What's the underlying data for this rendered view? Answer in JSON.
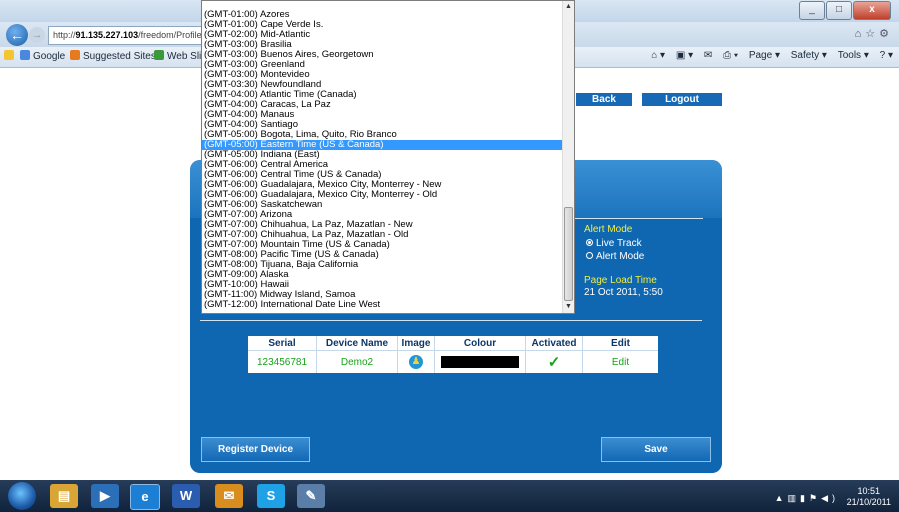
{
  "browser": {
    "url_prefix": "http://",
    "url_host": "91.135.227.103",
    "url_path": "/freedom/Profile",
    "favorites": [
      "Google",
      "Suggested Sites ▾",
      "Web Slice"
    ],
    "command_bar": [
      "Page ▾",
      "Safety ▾",
      "Tools ▾"
    ]
  },
  "nav": {
    "back_label": "Back",
    "logout_label": "Logout"
  },
  "timezone_dropdown": {
    "selected": "(GMT-05:00) Eastern Time (US & Canada)",
    "options": [
      "(GMT-01:00) Azores",
      "(GMT-01:00) Cape Verde Is.",
      "(GMT-02:00) Mid-Atlantic",
      "(GMT-03:00) Brasilia",
      "(GMT-03:00) Buenos Aires, Georgetown",
      "(GMT-03:00) Greenland",
      "(GMT-03:00) Montevideo",
      "(GMT-03:30) Newfoundland",
      "(GMT-04:00) Atlantic Time (Canada)",
      "(GMT-04:00) Caracas, La Paz",
      "(GMT-04:00) Manaus",
      "(GMT-04:00) Santiago",
      "(GMT-05:00) Bogota, Lima, Quito, Rio Branco",
      "(GMT-05:00) Eastern Time (US & Canada)",
      "(GMT-05:00) Indiana (East)",
      "(GMT-06:00) Central America",
      "(GMT-06:00) Central Time (US & Canada)",
      "(GMT-06:00) Guadalajara, Mexico City, Monterrey - New",
      "(GMT-06:00) Guadalajara, Mexico City, Monterrey - Old",
      "(GMT-06:00) Saskatchewan",
      "(GMT-07:00) Arizona",
      "(GMT-07:00) Chihuahua, La Paz, Mazatlan - New",
      "(GMT-07:00) Chihuahua, La Paz, Mazatlan - Old",
      "(GMT-07:00) Mountain Time (US & Canada)",
      "(GMT-08:00) Pacific Time (US & Canada)",
      "(GMT-08:00) Tijuana, Baja California",
      "(GMT-09:00) Alaska",
      "(GMT-10:00) Hawaii",
      "(GMT-11:00) Midway Island, Samoa",
      "(GMT-12:00) International Date Line West"
    ]
  },
  "alert_mode": {
    "title": "Alert Mode",
    "options": [
      "Live Track",
      "Alert Mode"
    ],
    "selected": "Live Track"
  },
  "page_load": {
    "title": "Page Load Time",
    "value": "21 Oct 2011, 5:50"
  },
  "device_table": {
    "headers": [
      "Serial",
      "Device Name",
      "Image",
      "Colour",
      "Activated",
      "Edit"
    ],
    "rows": [
      {
        "serial": "123456781",
        "device_name": "Demo2",
        "image": "person-icon",
        "colour": "#000000",
        "activated": "✓",
        "edit": "Edit"
      }
    ]
  },
  "buttons": {
    "register": "Register Device",
    "save": "Save"
  },
  "taskbar": {
    "time": "10:51",
    "date": "21/10/2011"
  },
  "colors": {
    "panel_blue": "#0f66b1",
    "highlight": "#3399ff",
    "accent_yellow": "#f4ef3a",
    "green_text": "#15a319"
  }
}
